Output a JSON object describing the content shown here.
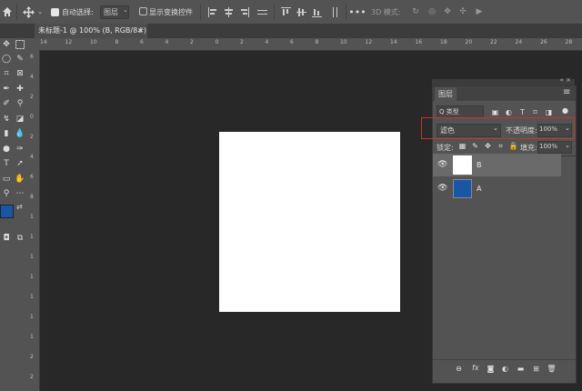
{
  "options_bar": {
    "auto_select_label": "自动选择:",
    "auto_select_target": "图层",
    "show_transform_label": "显示变换控件",
    "mode_3d_label": "3D 模式:"
  },
  "tab": {
    "title": "未标题-1 @ 100% (B, RGB/8#) *",
    "close": "×"
  },
  "ruler": {
    "h_ticks": [
      "14",
      "12",
      "10",
      "8",
      "6",
      "4",
      "2",
      "0",
      "2",
      "4",
      "6",
      "8",
      "10",
      "12",
      "14",
      "16",
      "18",
      "20",
      "22",
      "24",
      "26",
      "28"
    ],
    "v_ticks": [
      "6",
      "4",
      "2",
      "0",
      "2",
      "4",
      "6",
      "8",
      "1",
      "1",
      "1",
      "1",
      "1",
      "1",
      "1",
      "2",
      "2"
    ]
  },
  "colors": {
    "foreground": "#1a56a8",
    "background": "#ffffff",
    "layer_a_color": "#1a56a8",
    "highlight_box": "#c0392b"
  },
  "layers_panel": {
    "title": "图层",
    "filter_label": "Q 类型",
    "blend_mode": "滤色",
    "opacity_label": "不透明度:",
    "opacity_value": "100%",
    "lock_label": "锁定:",
    "fill_label": "填充:",
    "fill_value": "100%",
    "layers": [
      {
        "name": "B",
        "visible": true,
        "selected": true
      },
      {
        "name": "A",
        "visible": true,
        "selected": false
      }
    ],
    "footer_fx": "fx"
  }
}
